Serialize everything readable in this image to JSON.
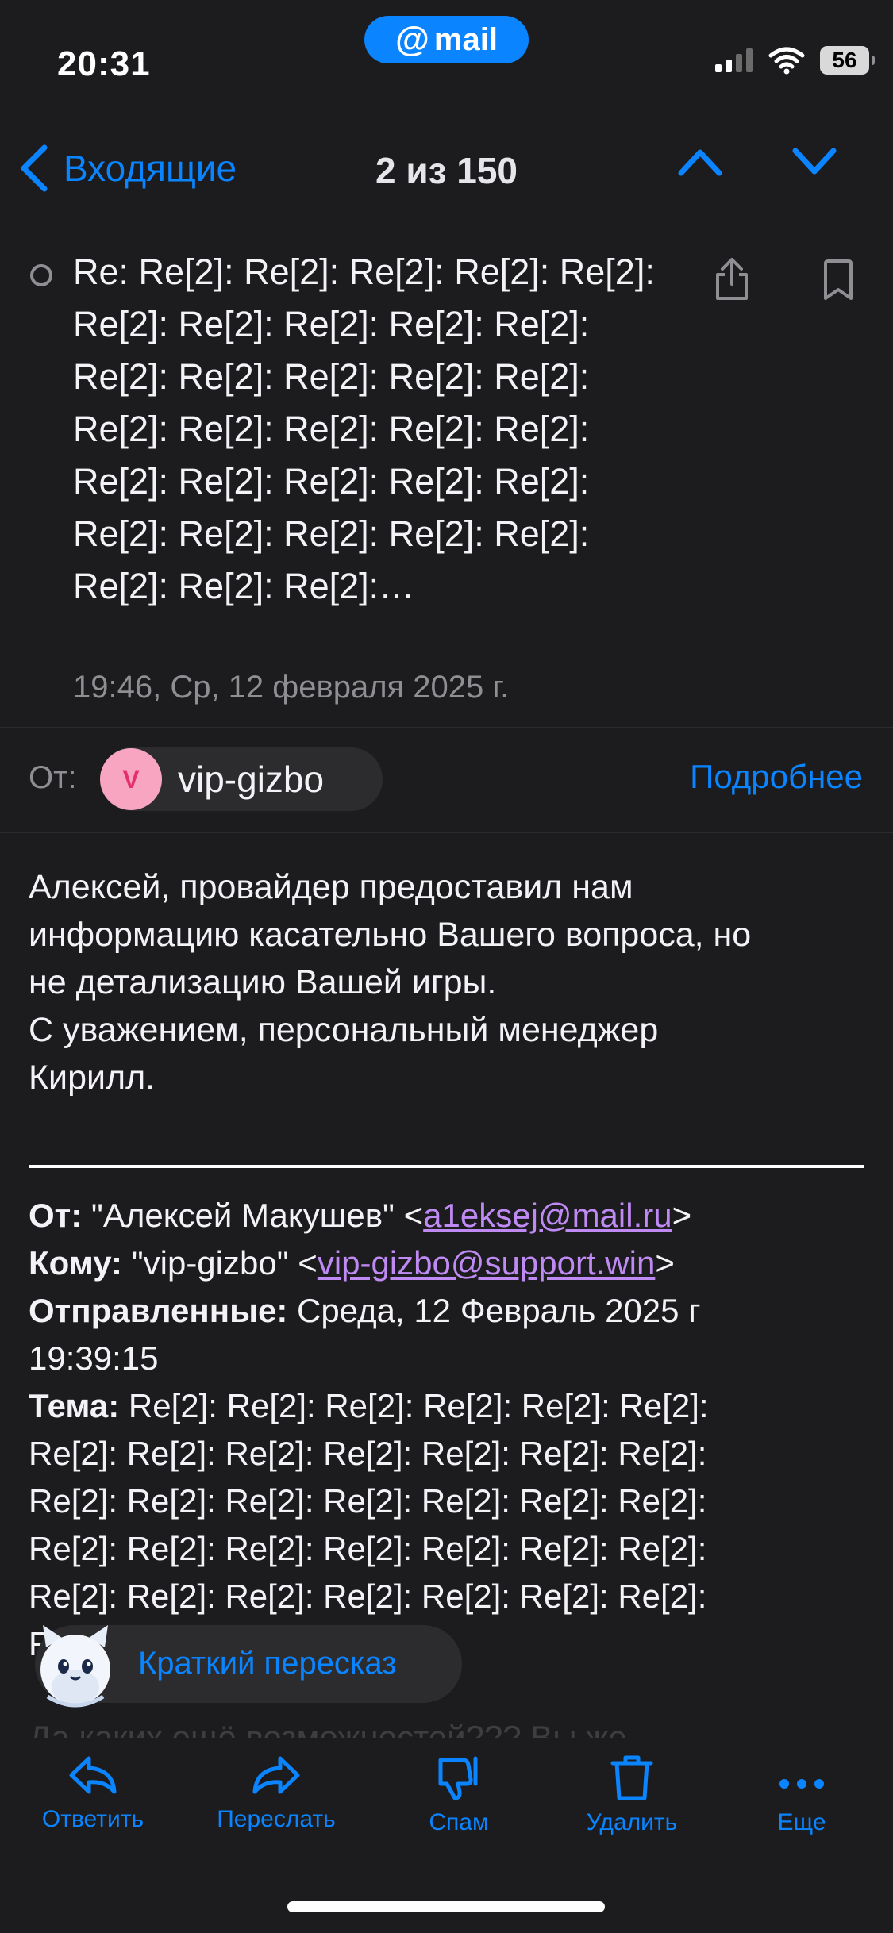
{
  "status_bar": {
    "time": "20:31",
    "app_badge": "mail",
    "battery": "56"
  },
  "nav": {
    "back_label": "Входящие",
    "counter": "2 из 150"
  },
  "message": {
    "subject": "Re: Re[2]: Re[2]: Re[2]: Re[2]: Re[2]: Re[2]: Re[2]: Re[2]: Re[2]: Re[2]: Re[2]: Re[2]: Re[2]: Re[2]: Re[2]: Re[2]: Re[2]: Re[2]: Re[2]: Re[2]: Re[2]: Re[2]: Re[2]: Re[2]: Re[2]: Re[2]: Re[2]: Re[2]: Re[2]: Re[2]: Re[2]: Re[2]: Re[2]:…",
    "date": "19:46, Ср, 12 февраля 2025 г.",
    "from_label": "От:",
    "sender_initial": "V",
    "sender_name": "vip-gizbo",
    "details_link": "Подробнее",
    "body_lines": [
      "Алексей, провайдер предоставил нам",
      "информацию касательно Вашего вопроса, но",
      "не детализацию Вашей игры.",
      "С уважением, персональный менеджер",
      "Кирилл."
    ],
    "quoted": {
      "from_label": "От:",
      "from_name": " \"Алексей Макушев\" <",
      "from_email": "a1eksej@mail.ru",
      "to_label": "Кому:",
      "to_name": " \"vip-gizbo\" <",
      "to_email": "vip-gizbo@support.win",
      "sent_label": "Отправленные:",
      "sent_value": " Среда, 12 Февраль 2025 г",
      "sent_time": "19:39:15",
      "subject_label": "Тема:",
      "subject_first": " Re[2]: Re[2]: Re[2]: Re[2]: Re[2]: Re[2]:",
      "subject_line": "Re[2]: Re[2]: Re[2]: Re[2]: Re[2]: Re[2]: Re[2]:",
      "subject_tail": "Re",
      "faded_line": "Да каких ещё возможностей??? Вы же"
    }
  },
  "summary": {
    "label": "Краткий пересказ"
  },
  "toolbar": {
    "reply": "Ответить",
    "forward": "Переслать",
    "spam": "Спам",
    "delete": "Удалить",
    "more": "Еще"
  },
  "colors": {
    "accent": "#0a84ff",
    "background": "#1c1c1e",
    "link": "#c08af5"
  }
}
